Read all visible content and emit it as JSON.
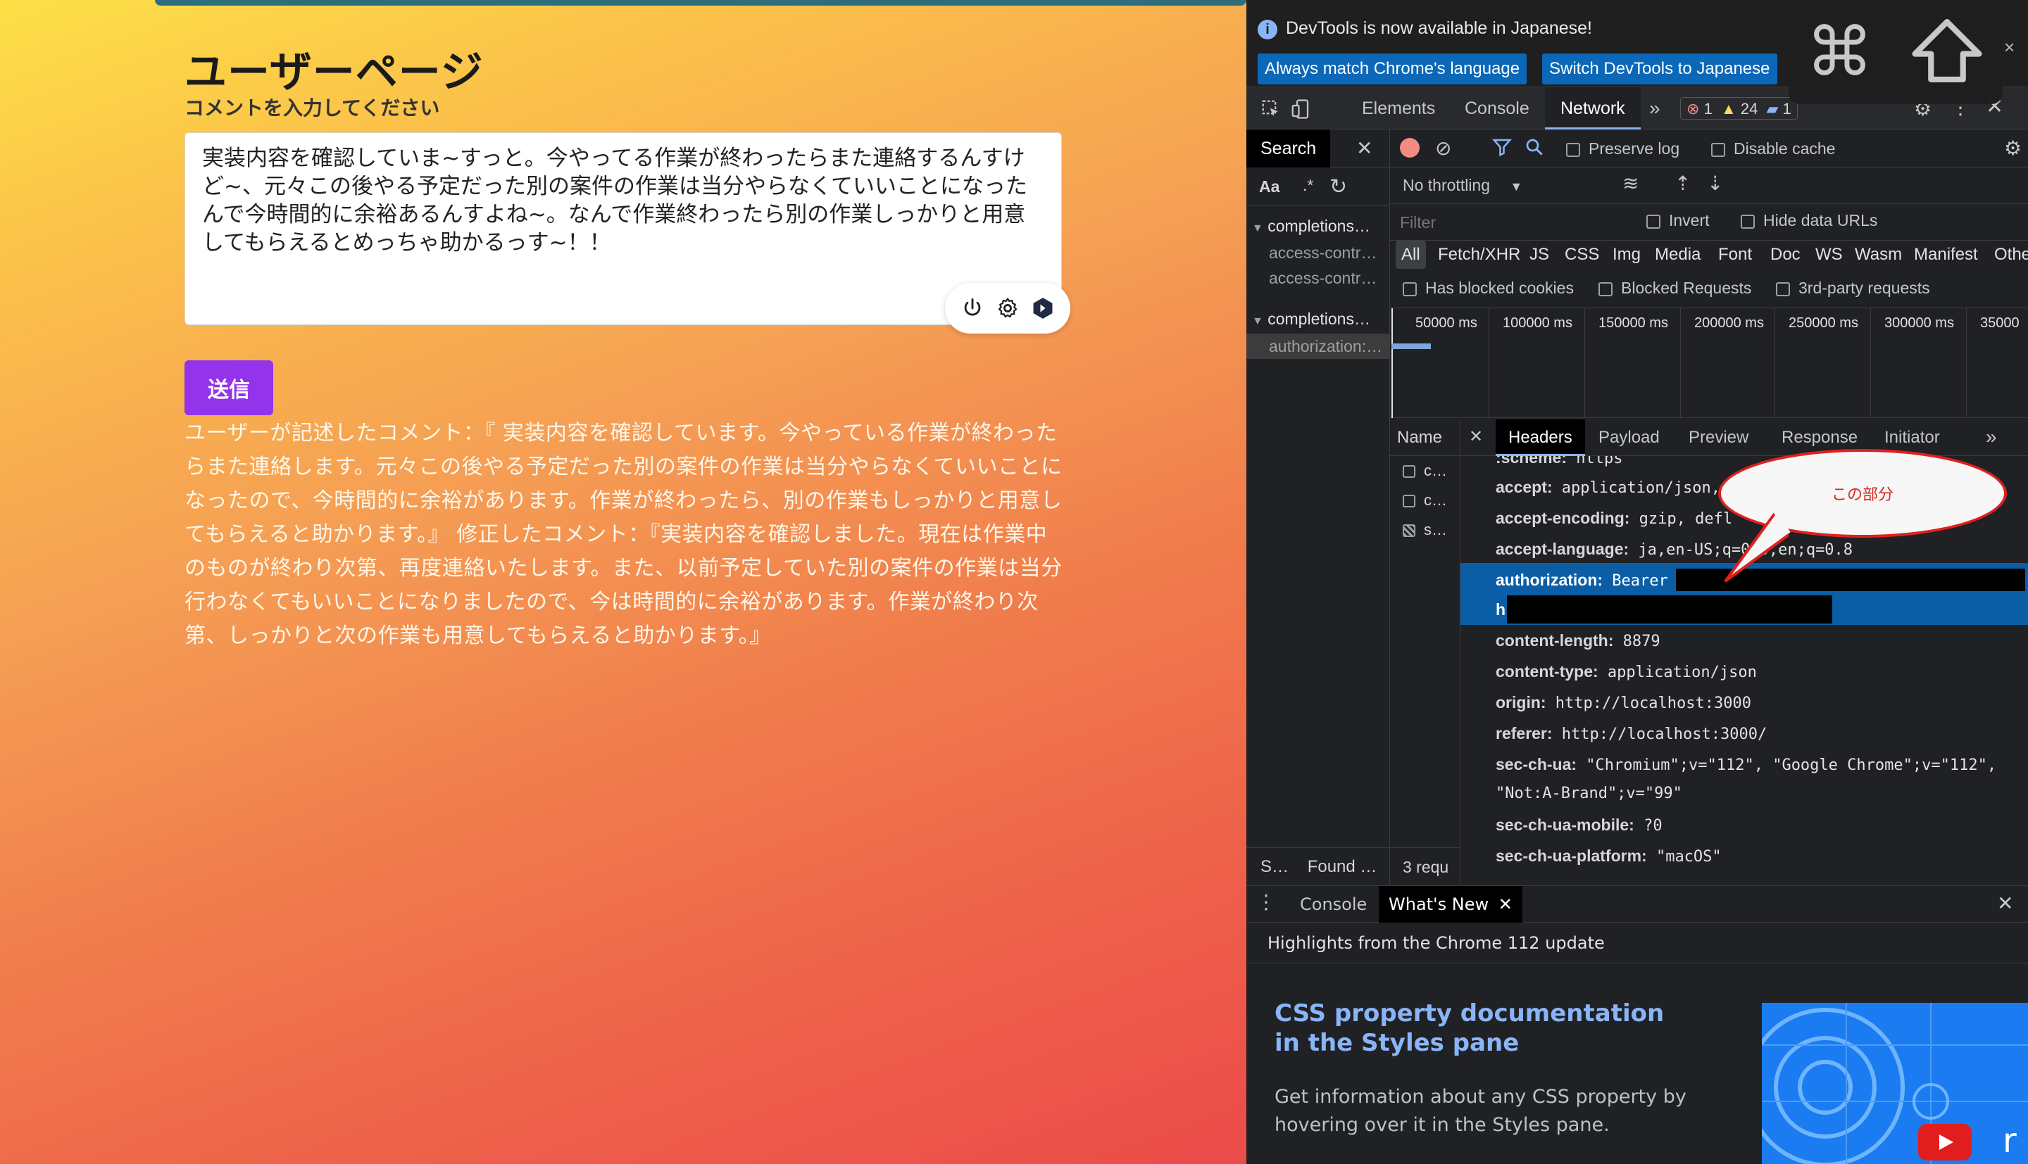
{
  "app": {
    "title": "ユーザーページ",
    "prompt_label": "コメントを入力してください",
    "comment_value": "実装内容を確認していま~すっと。今やってる作業が終わったらまた連絡するんすけど~、元々この後やる予定だった別の案件の作業は当分やらなくていいことになったんで今時間的に余裕あるんすよね~。なんで作業終わったら別の作業しっかりと用意してもらえるとめっちゃ助かるっす~！！",
    "submit_label": "送信",
    "result_text": "ユーザーが記述したコメント：『 実装内容を確認しています。今やっている作業が終わったらまた連絡します。元々この後やる予定だった別の案件の作業は当分やらなくていいことになったので、今時間的に余裕があります。作業が終わったら、別の作業もしっかりと用意してもらえると助かります。』 修正したコメント：『実装内容を確認しました。現在は作業中のものが終わり次第、再度連絡いたします。また、以前予定していた別の案件の作業は当分行わなくてもいいことになりましたので、今は時間的に余裕があります。作業が終わり次第、しっかりと次の作業も用意してもらえると助かります。』"
  },
  "devtools": {
    "info_message": "DevTools is now available in Japanese!",
    "btn_match": "Always match Chrome's language",
    "btn_switch": "Switch DevTools to Japanese",
    "tabs": [
      "Elements",
      "Console",
      "Network"
    ],
    "active_tab": "Network",
    "errors": "1",
    "warnings": "24",
    "messages": "1",
    "search_tab": "Search",
    "aa": "Aa",
    "regex": ".*",
    "search_results": [
      {
        "label": "completions…",
        "children": [
          "access-contr…",
          "access-contr…"
        ]
      },
      {
        "label": "completions…",
        "children": [
          "authorization:…"
        ]
      }
    ],
    "search_status_1": "S…",
    "search_status_2": "Found …",
    "preserve_log": "Preserve log",
    "disable_cache": "Disable cache",
    "throttling": "No throttling",
    "filter_placeholder": "Filter",
    "invert": "Invert",
    "hide_data_urls": "Hide data URLs",
    "types": [
      "All",
      "Fetch/XHR",
      "JS",
      "CSS",
      "Img",
      "Media",
      "Font",
      "Doc",
      "WS",
      "Wasm",
      "Manifest",
      "Othe"
    ],
    "blocked_cookies": "Has blocked cookies",
    "blocked_requests": "Blocked Requests",
    "third_party": "3rd-party requests",
    "timeline": [
      "50000 ms",
      "100000 ms",
      "150000 ms",
      "200000 ms",
      "250000 ms",
      "300000 ms",
      "35000"
    ],
    "name_col": "Name",
    "requests": [
      "c…",
      "c…",
      "s…"
    ],
    "requests_count": "3 requ",
    "detail_tabs": [
      "Headers",
      "Payload",
      "Preview",
      "Response",
      "Initiator"
    ],
    "headers": [
      {
        "k": ":scheme:",
        "v": "https"
      },
      {
        "k": "accept:",
        "v": "application/json,"
      },
      {
        "k": "accept-encoding:",
        "v": "gzip, defl"
      },
      {
        "k": "accept-language:",
        "v": "ja,en-US;q=0.9,en;q=0.8"
      },
      {
        "k": "authorization:",
        "v": "Bearer"
      },
      {
        "k": "h",
        "v": ""
      },
      {
        "k": "content-length:",
        "v": "8879"
      },
      {
        "k": "content-type:",
        "v": "application/json"
      },
      {
        "k": "origin:",
        "v": "http://localhost:3000"
      },
      {
        "k": "referer:",
        "v": "http://localhost:3000/"
      },
      {
        "k": "sec-ch-ua:",
        "v": "\"Chromium\";v=\"112\", \"Google Chrome\";v=\"112\","
      },
      {
        "k": "",
        "v": "\"Not:A-Brand\";v=\"99\""
      },
      {
        "k": "sec-ch-ua-mobile:",
        "v": "?0"
      },
      {
        "k": "sec-ch-ua-platform:",
        "v": "\"macOS\""
      }
    ],
    "annotation": "この部分",
    "drawer_tabs": [
      "Console",
      "What's New"
    ],
    "highlights": "Highlights from the Chrome 112 update",
    "card_title": "CSS property documentation in the Styles pane",
    "card_body": "Get information about any CSS property by hovering over it in the Styles pane."
  }
}
